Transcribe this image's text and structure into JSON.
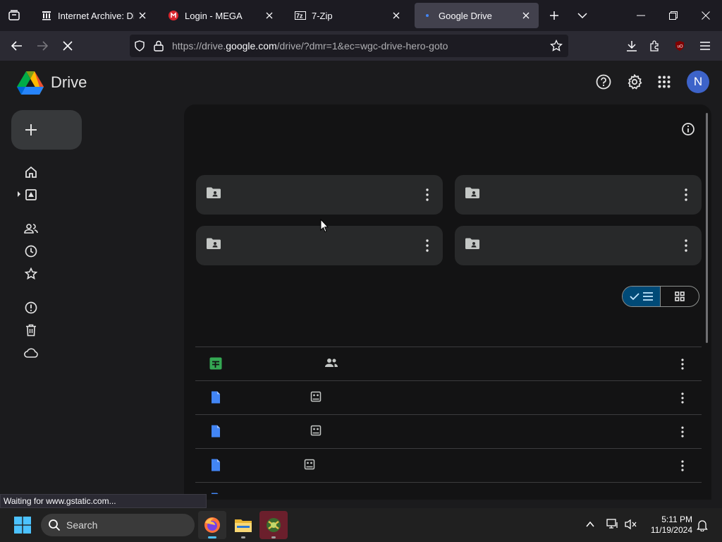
{
  "browser": {
    "tabs": [
      {
        "title": "Internet Archive: Digital",
        "icon": "archive-icon",
        "active": false
      },
      {
        "title": "Login - MEGA",
        "icon": "mega-icon",
        "active": false
      },
      {
        "title": "7-Zip",
        "icon": "7zip-icon",
        "active": false
      },
      {
        "title": "Google Drive",
        "icon": "drive-icon",
        "active": true
      }
    ],
    "url": {
      "prefix": "https://drive.",
      "domain": "google.com",
      "path": "/drive/?dmr=1&ec=wgc-drive-hero-goto"
    },
    "status": "Waiting for www.gstatic.com..."
  },
  "drive": {
    "app_name": "Drive",
    "avatar_letter": "N",
    "colors": {
      "accent": "#004a77",
      "avatar": "#3d63c9"
    }
  },
  "taskbar": {
    "search_placeholder": "Search",
    "time": "5:11 PM",
    "date": "11/19/2024"
  }
}
